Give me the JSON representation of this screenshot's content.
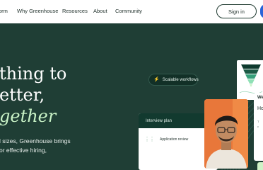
{
  "nav": {
    "links": [
      "orm",
      "Why Greenhouse",
      "Resources",
      "About",
      "Community"
    ],
    "sign_in": "Sign in"
  },
  "hero": {
    "headline_lines": [
      "thing to",
      "etter,",
      "gether"
    ],
    "body_lines": [
      "l sizes, Greenhouse brings",
      "or effective hiring,"
    ],
    "pill_label": "Scalable workflows",
    "pill_icon": "lightning-icon"
  },
  "interview_card": {
    "title": "Interview plan",
    "row_label": "Application review"
  },
  "message_card": {
    "line1": "We",
    "line2": "Ho",
    "line3": "T",
    "line4": "c"
  },
  "colors": {
    "hero_bg": "#1f3e35",
    "accent_green": "#c8f2c6",
    "card_header": "#123a2f",
    "cta_blue": "#2a63d8"
  }
}
